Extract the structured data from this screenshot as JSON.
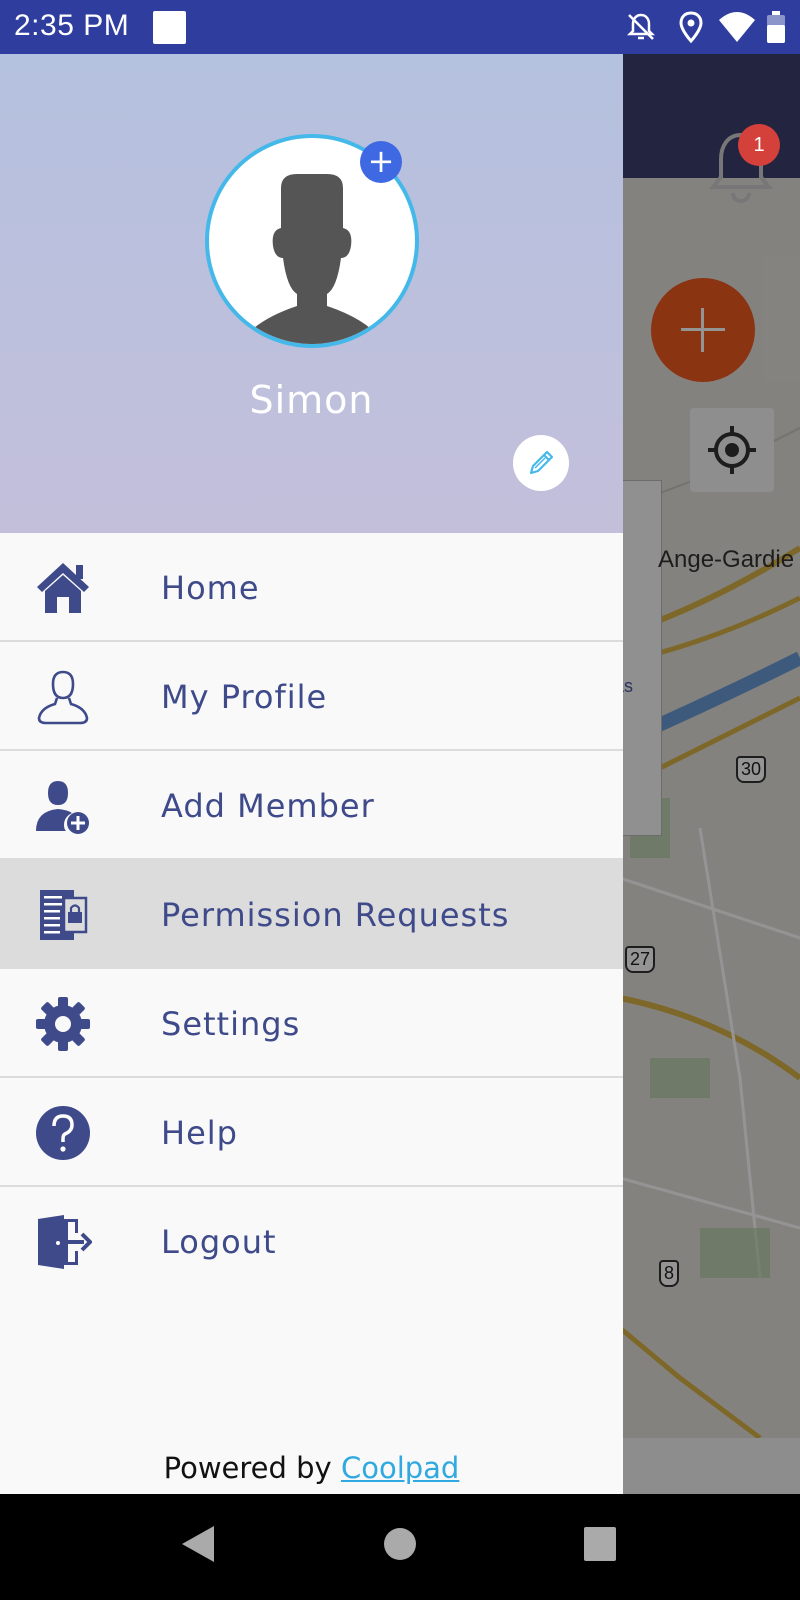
{
  "status_bar": {
    "time": "2:35 PM",
    "icons": [
      "notification-square-icon",
      "bell-off-icon",
      "location-icon",
      "wifi-icon",
      "battery-icon"
    ]
  },
  "app": {
    "notification_count": "1",
    "map_labels": [
      "Ange-Gardie",
      "as"
    ],
    "route_shields": [
      "30",
      "27",
      "8"
    ]
  },
  "drawer": {
    "user_name": "Simon",
    "menu": [
      {
        "label": "Home",
        "icon": "home-icon"
      },
      {
        "label": "My Profile",
        "icon": "profile-icon"
      },
      {
        "label": "Add Member",
        "icon": "add-member-icon"
      },
      {
        "label": "Permission Requests",
        "icon": "permission-requests-icon"
      },
      {
        "label": "Settings",
        "icon": "gear-icon"
      },
      {
        "label": "Help",
        "icon": "help-icon"
      },
      {
        "label": "Logout",
        "icon": "logout-icon"
      }
    ],
    "active_item": "Permission Requests",
    "footer": {
      "prefix": "Powered by ",
      "link": "Coolpad"
    }
  },
  "colors": {
    "status_bar": "#2f3e9e",
    "menu_text": "#3e4a8a",
    "accent_blue": "#3e69e3",
    "avatar_ring": "#45b8ea",
    "link": "#2fa9e0",
    "fab": "#f05a1e",
    "badge": "#d4403a"
  }
}
